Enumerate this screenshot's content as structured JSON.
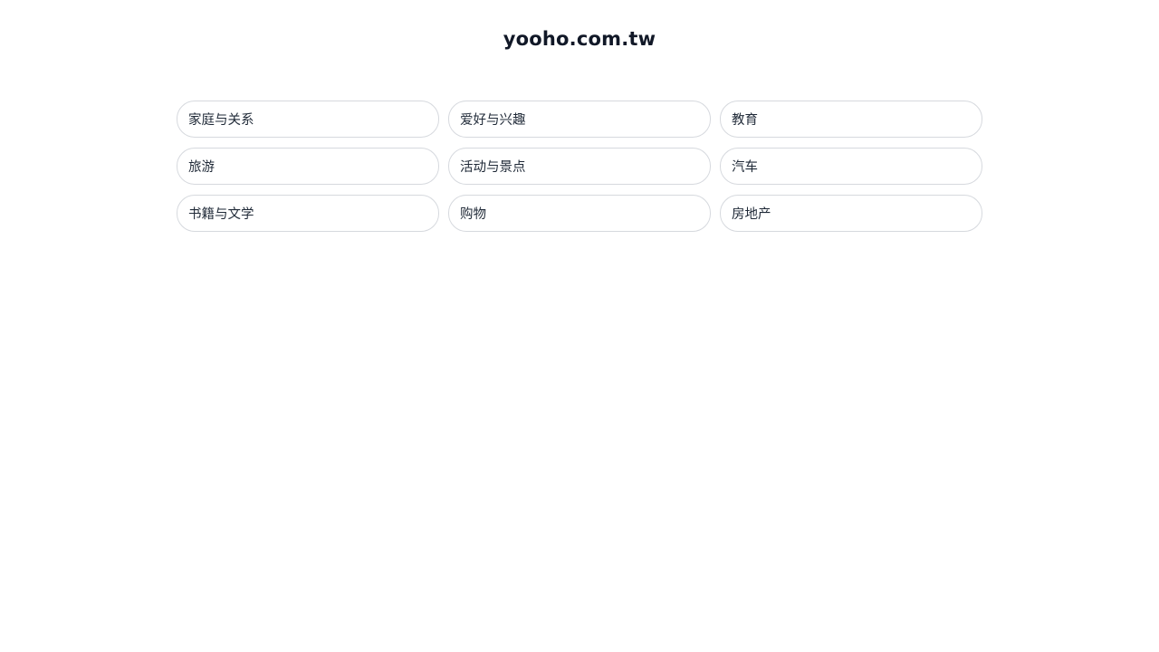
{
  "header": {
    "site_title": "yooho.com.tw"
  },
  "categories": [
    {
      "label": "家庭与关系"
    },
    {
      "label": "爱好与兴趣"
    },
    {
      "label": "教育"
    },
    {
      "label": "旅游"
    },
    {
      "label": "活动与景点"
    },
    {
      "label": "汽车"
    },
    {
      "label": "书籍与文学"
    },
    {
      "label": "购物"
    },
    {
      "label": "房地产"
    }
  ]
}
